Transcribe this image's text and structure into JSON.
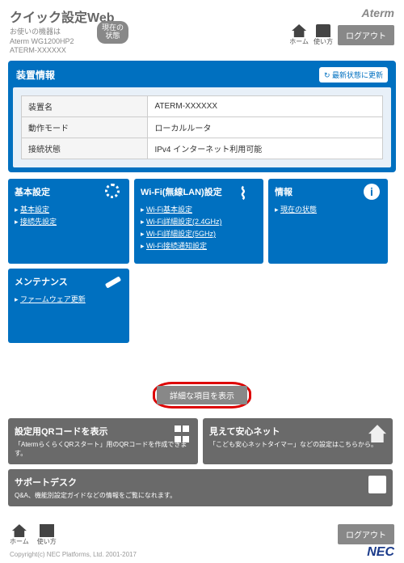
{
  "header": {
    "title": "クイック設定Web",
    "subtitle_line1": "お使いの機器は",
    "subtitle_line2": "Aterm WG1200HP2",
    "subtitle_line3": "ATERM-XXXXXX",
    "brand": "Aterm",
    "status_badge_line1": "現在の",
    "status_badge_line2": "状態",
    "home_label": "ホーム",
    "usage_label": "使い方",
    "logout_label": "ログアウト"
  },
  "device_info": {
    "title": "装置情報",
    "refresh_label": "↻ 最新状態に更新",
    "rows": [
      {
        "label": "装置名",
        "value": "ATERM-XXXXXX"
      },
      {
        "label": "動作モード",
        "value": "ローカルルータ"
      },
      {
        "label": "接続状態",
        "value": "IPv4 インターネット利用可能"
      }
    ]
  },
  "cards": {
    "basic": {
      "title": "基本設定",
      "items": [
        "基本設定",
        "接続先設定"
      ]
    },
    "wifi": {
      "title": "Wi-Fi(無線LAN)設定",
      "items": [
        "Wi-Fi基本設定",
        "Wi-Fi詳細設定(2.4GHz)",
        "Wi-Fi詳細設定(5GHz)",
        "Wi-Fi接続通知設定"
      ]
    },
    "info": {
      "title": "情報",
      "items": [
        "現在の状態"
      ]
    },
    "maintenance": {
      "title": "メンテナンス",
      "items": [
        "ファームウェア更新"
      ]
    }
  },
  "detail_button": "詳細な項目を表示",
  "grey": {
    "qr": {
      "title": "設定用QRコードを表示",
      "desc": "「AtermらくらくQRスタート」用のQRコードを作成できます。"
    },
    "safety": {
      "title": "見えて安心ネット",
      "desc": "「こども安心ネットタイマー」などの設定はこちらから。"
    },
    "support": {
      "title": "サポートデスク",
      "desc": "Q&A、機能別設定ガイドなどの情報をご覧になれます。"
    }
  },
  "footer": {
    "home_label": "ホーム",
    "usage_label": "使い方",
    "logout_label": "ログアウト",
    "copyright": "Copyright(c) NEC Platforms, Ltd. 2001-2017",
    "nec": "NEC"
  }
}
